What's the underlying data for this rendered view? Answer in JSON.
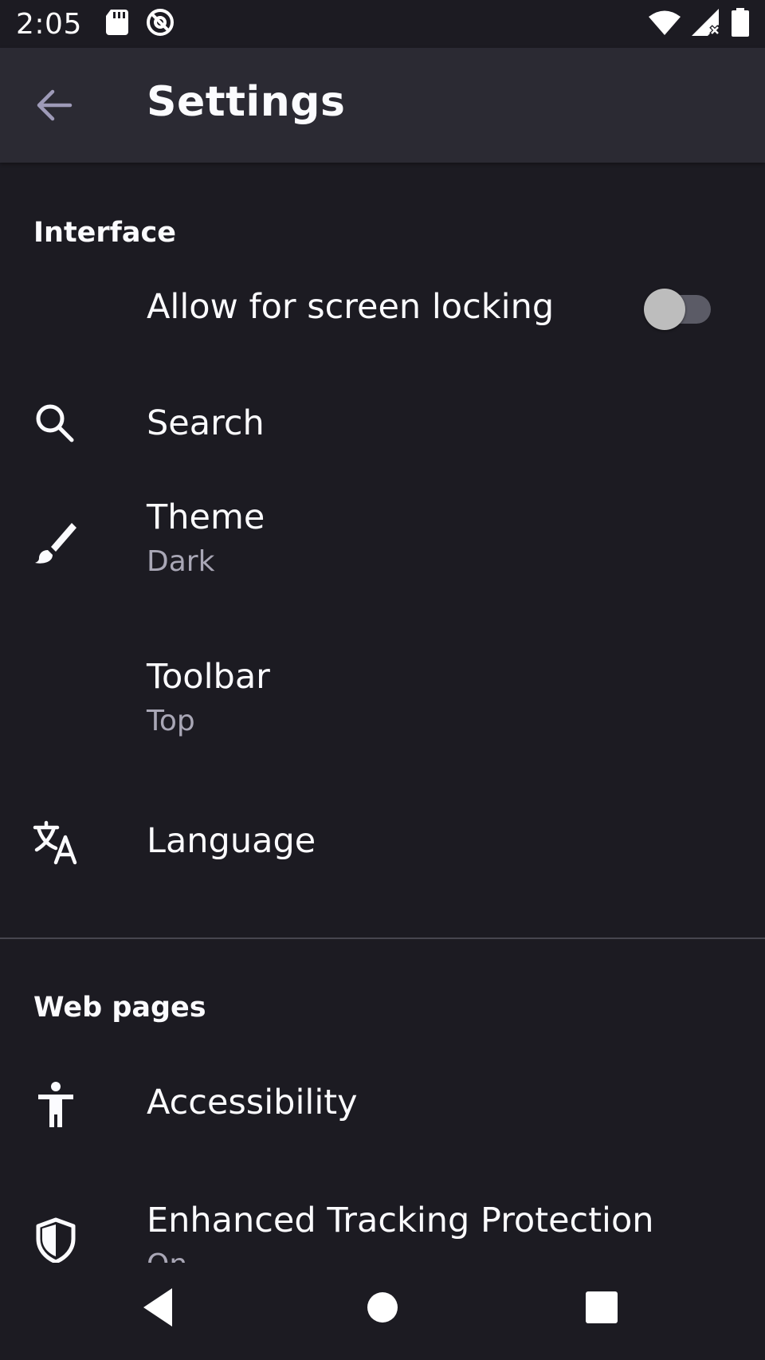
{
  "status_bar": {
    "time": "2:05",
    "icons": [
      "sd-card-icon",
      "at-sign-icon",
      "wifi-icon",
      "cell-signal-icon",
      "battery-icon"
    ]
  },
  "toolbar": {
    "title": "Settings",
    "back_icon": "arrow-back-icon"
  },
  "sections": {
    "interface": {
      "title": "Interface"
    },
    "web_pages": {
      "title": "Web pages"
    }
  },
  "rows": {
    "screen_lock": {
      "label": "Allow for screen locking",
      "toggle_on": false
    },
    "search": {
      "label": "Search",
      "icon": "search-icon"
    },
    "theme": {
      "label": "Theme",
      "value": "Dark",
      "icon": "brush-icon"
    },
    "toolbar": {
      "label": "Toolbar",
      "value": "Top"
    },
    "language": {
      "label": "Language",
      "icon": "translate-icon"
    },
    "accessibility": {
      "label": "Accessibility",
      "icon": "accessibility-icon"
    },
    "tracking": {
      "label": "Enhanced Tracking Protection",
      "value": "On",
      "icon": "shield-icon"
    }
  },
  "nav_bar": {
    "back": "nav-back-icon",
    "home": "nav-home-icon",
    "recents": "nav-recents-icon"
  },
  "colors": {
    "background": "#1c1b22",
    "toolbar": "#2b2a33",
    "text_primary": "#fbfbfe",
    "text_secondary": "#a9a7b6",
    "back_arrow": "#9e9ab8"
  }
}
